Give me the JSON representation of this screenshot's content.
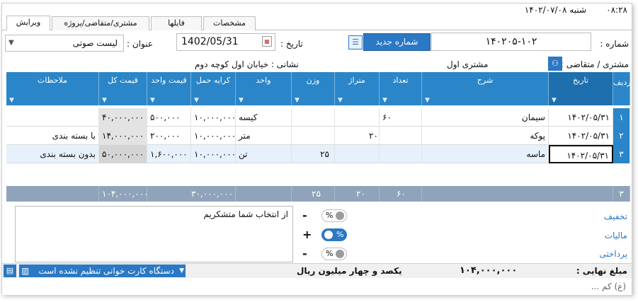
{
  "header": {
    "time": "۰۸:۲۸",
    "date": "شنبه ۱۴۰۲/۰۷/۰۸"
  },
  "tabs": [
    {
      "label": "ویرایش"
    },
    {
      "label": "مشتری/متقاضی/پروژه"
    },
    {
      "label": "فایلها"
    },
    {
      "label": "مشخصات"
    }
  ],
  "form": {
    "number_label": "شماره :",
    "number_value": "۱۴۰۲۰۵-۱۰۲",
    "new_number_button": "شماره جدید",
    "date_label": "تاریخ :",
    "date_value": "1402/05/31",
    "title_label": "عنوان :",
    "title_value": "لیست صوتی",
    "customer_label": "مشتری / متقاضی :",
    "customer_value": "مشتری اول",
    "address": "نشانی : خیابان اول کوچه دوم"
  },
  "grid": {
    "headers": [
      "ردیف",
      "تاریخ",
      "شرح",
      "تعداد",
      "متراژ",
      "وزن",
      "واحد",
      "کرایه حمل",
      "قیمت واحد",
      "قیمت کل",
      "ملاحظات"
    ],
    "rows": [
      {
        "n": "۱",
        "date": "۱۴۰۲/۰۵/۳۱",
        "desc": "سیمان",
        "count": "۶۰",
        "area": "",
        "weight": "",
        "unit": "کیسه",
        "freight": "۱۰,۰۰۰,۰۰۰",
        "unit_price": "۵۰۰,۰۰۰",
        "total": "۴۰,۰۰۰,۰۰۰",
        "notes": ""
      },
      {
        "n": "۲",
        "date": "۱۴۰۲/۰۵/۳۱",
        "desc": "پوکه",
        "count": "",
        "area": "۲۰",
        "weight": "",
        "unit": "متر",
        "freight": "۱۰,۰۰۰,۰۰۰",
        "unit_price": "۲۰۰,۰۰۰",
        "total": "۱۴,۰۰۰,۰۰۰",
        "notes": "با بسته بندی"
      },
      {
        "n": "۳",
        "date": "۱۴۰۲/۰۵/۳۱",
        "desc": "ماسه",
        "count": "",
        "area": "",
        "weight": "۲۵",
        "unit": "تن",
        "freight": "۱۰,۰۰۰,۰۰۰",
        "unit_price": "۱,۶۰۰,۰۰۰",
        "total": "۵۰,۰۰۰,۰۰۰",
        "notes": "بدون بسته بندی"
      }
    ],
    "summary": {
      "n": "۳",
      "count": "۶۰",
      "area": "۲۰",
      "weight": "۲۵",
      "freight": "۳۰,۰۰۰,۰۰۰",
      "total": "۱۰۴,۰۰۰,۰۰۰"
    }
  },
  "adjust": {
    "discount_label": "تخفیف",
    "tax_label": "مالیات",
    "payment_label": "پرداختی",
    "pct": "%",
    "minus": "-",
    "plus": "+"
  },
  "note_text": "از انتخاب شما متشکریم",
  "final": {
    "label": "مبلغ نهایی :",
    "amount": "۱۰۴,۰۰۰,۰۰۰",
    "words": "یکصد و چهار میلیون ریال"
  },
  "card_reader": {
    "status": "دستگاه کارت خوانی تنظیم نشده است"
  },
  "bottom": {
    "hint": "(ع) کم ..."
  },
  "colors": {
    "accent": "#2a86c8",
    "summary": "#8fa4ba",
    "selected_row": "#e6f1fb",
    "calc_cell": "#e3e3e3"
  }
}
